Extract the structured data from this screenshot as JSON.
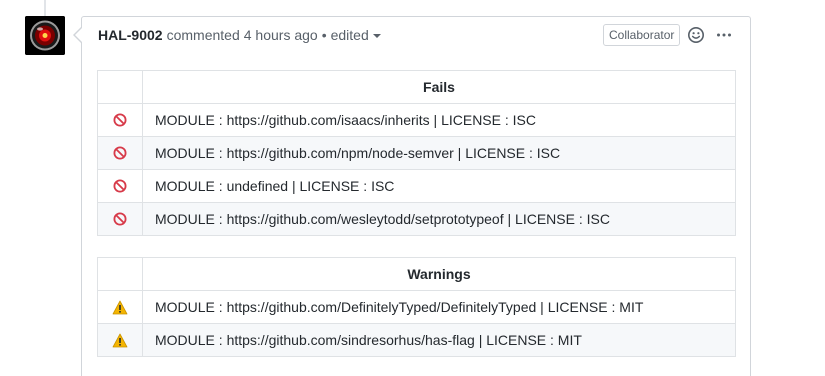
{
  "comment": {
    "author": "HAL-9002",
    "action": "commented",
    "time": "4 hours ago",
    "separator": "•",
    "edited_label": "edited",
    "badge": "Collaborator"
  },
  "icons": {
    "avatar": "hal-9000-eye",
    "reaction": "smiley-icon",
    "more": "kebab-horizontal-icon",
    "fail": "no-entry-icon",
    "warning": "warning-icon"
  },
  "colors": {
    "fail_icon": "#d73a49",
    "warning_icon": "#f4b400",
    "border": "#d1d5da"
  },
  "fails_table": {
    "header": "Fails",
    "rows": [
      "MODULE : https://github.com/isaacs/inherits | LICENSE : ISC",
      "MODULE : https://github.com/npm/node-semver | LICENSE : ISC",
      "MODULE : undefined | LICENSE : ISC",
      "MODULE : https://github.com/wesleytodd/setprototypeof | LICENSE : ISC"
    ]
  },
  "warnings_table": {
    "header": "Warnings",
    "rows": [
      "MODULE : https://github.com/DefinitelyTyped/DefinitelyTyped | LICENSE : MIT",
      "MODULE : https://github.com/sindresorhus/has-flag | LICENSE : MIT"
    ]
  }
}
